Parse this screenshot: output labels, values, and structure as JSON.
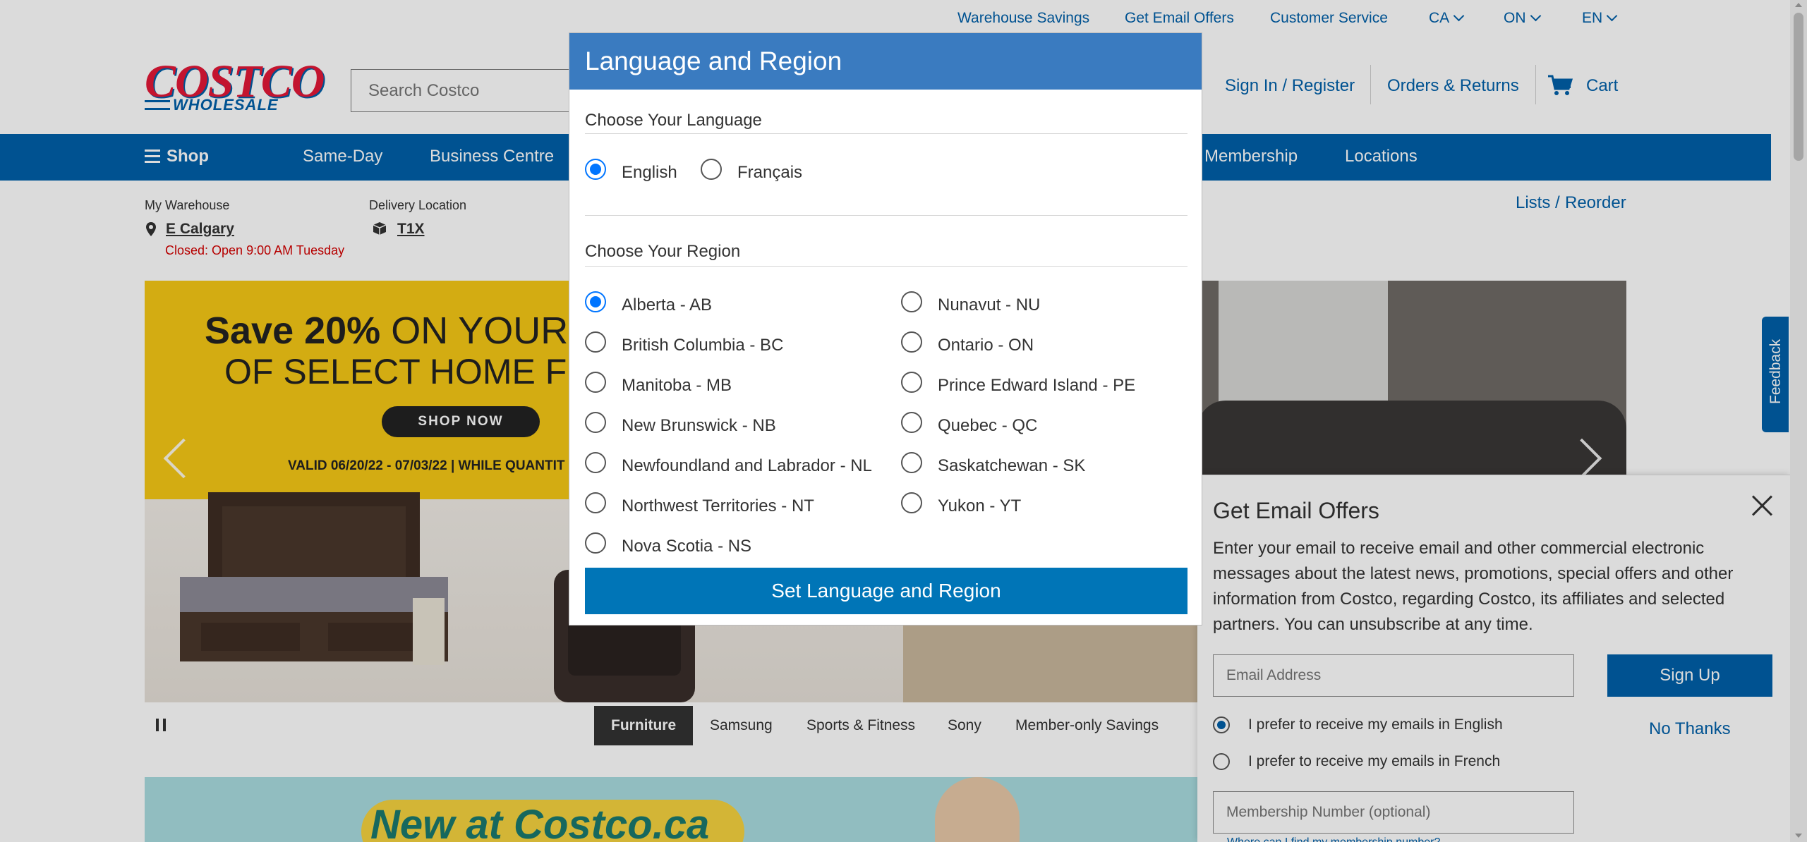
{
  "utility_nav": {
    "warehouse_savings": "Warehouse Savings",
    "email_offers": "Get Email Offers",
    "customer_service": "Customer Service",
    "country": "CA",
    "province": "ON",
    "language": "EN"
  },
  "header": {
    "logo_top": "COSTCO",
    "logo_bottom": "WHOLESALE",
    "search_placeholder": "Search Costco",
    "sign_in": "Sign In / Register",
    "orders": "Orders & Returns",
    "cart": "Cart"
  },
  "main_nav": {
    "shop": "Shop",
    "same_day": "Same-Day",
    "business": "Business Centre",
    "membership": "Membership",
    "locations": "Locations"
  },
  "location_bar": {
    "warehouse_label": "My Warehouse",
    "warehouse_name": "E Calgary",
    "warehouse_status": "Closed: Open 9:00 AM Tuesday",
    "delivery_label": "Delivery Location",
    "delivery_code": "T1X",
    "lists": "Lists /",
    "reorder": "Reorder"
  },
  "hero": {
    "headline_bold": "Save 20%",
    "headline_rest": "ON YOUR PU",
    "line2": "OF SELECT HOME FUR",
    "cta": "SHOP NOW",
    "validity": "VALID 06/20/22 - 07/03/22 | WHILE QUANTIT"
  },
  "carousel_tabs": [
    "Furniture",
    "Samsung",
    "Sports & Fitness",
    "Sony",
    "Member-only Savings"
  ],
  "banner2": {
    "text": "New at Costco.ca"
  },
  "feedback": "Feedback",
  "email_panel": {
    "title": "Get Email Offers",
    "description": "Enter your email to receive email and other commercial electronic messages about the latest news, promotions, special offers and other information from Costco, regarding Costco, its affiliates and selected partners. You can unsubscribe at any time.",
    "email_placeholder": "Email Address",
    "sign_up": "Sign Up",
    "pref_english": "I prefer to receive my emails in English",
    "pref_french": "I prefer to receive my emails in French",
    "no_thanks": "No Thanks",
    "membership_placeholder": "Membership Number (optional)",
    "where_link": "Where can I find my membership number?"
  },
  "modal": {
    "title": "Language and Region",
    "language_heading": "Choose Your Language",
    "languages": [
      {
        "label": "English",
        "selected": true
      },
      {
        "label": "Français",
        "selected": false
      }
    ],
    "region_heading": "Choose Your Region",
    "regions_left": [
      {
        "label": "Alberta - AB",
        "selected": true
      },
      {
        "label": "British Columbia - BC",
        "selected": false
      },
      {
        "label": "Manitoba - MB",
        "selected": false
      },
      {
        "label": "New Brunswick - NB",
        "selected": false
      },
      {
        "label": "Newfoundland and Labrador - NL",
        "selected": false
      },
      {
        "label": "Northwest Territories - NT",
        "selected": false
      },
      {
        "label": "Nova Scotia - NS",
        "selected": false
      }
    ],
    "regions_right": [
      {
        "label": "Nunavut - NU",
        "selected": false
      },
      {
        "label": "Ontario - ON",
        "selected": false
      },
      {
        "label": "Prince Edward Island - PE",
        "selected": false
      },
      {
        "label": "Quebec - QC",
        "selected": false
      },
      {
        "label": "Saskatchewan - SK",
        "selected": false
      },
      {
        "label": "Yukon - YT",
        "selected": false
      }
    ],
    "submit": "Set Language and Region"
  },
  "colors": {
    "brand_blue": "#0060a9",
    "brand_red": "#e31837",
    "modal_header": "#3a7bc0",
    "radio_selected": "#0075ff"
  }
}
